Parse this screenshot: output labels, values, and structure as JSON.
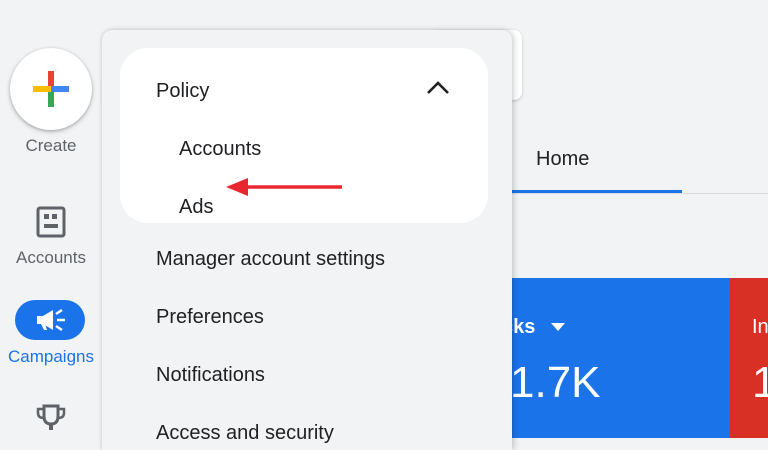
{
  "rail": {
    "create_label": "Create",
    "accounts_label": "Accounts",
    "campaigns_label": "Campaigns"
  },
  "menu": {
    "policy_label": "Policy",
    "policy_children": [
      "Accounts",
      "Ads"
    ],
    "items": [
      "Manager account settings",
      "Preferences",
      "Notifications",
      "Access and security"
    ]
  },
  "main": {
    "tab_home": "Home",
    "metric_clicks_label": "cks",
    "metric_clicks_value": "1.7K",
    "metric_impr_label": "In",
    "metric_impr_value": "1"
  },
  "colors": {
    "accent": "#1a73e8",
    "red": "#d93025",
    "arrow": "#e8282e"
  },
  "icons": [
    "plus-icon",
    "accounts-icon",
    "megaphone-icon",
    "trophy-icon",
    "chevron-up-icon",
    "caret-down-icon",
    "annotation-arrow"
  ]
}
